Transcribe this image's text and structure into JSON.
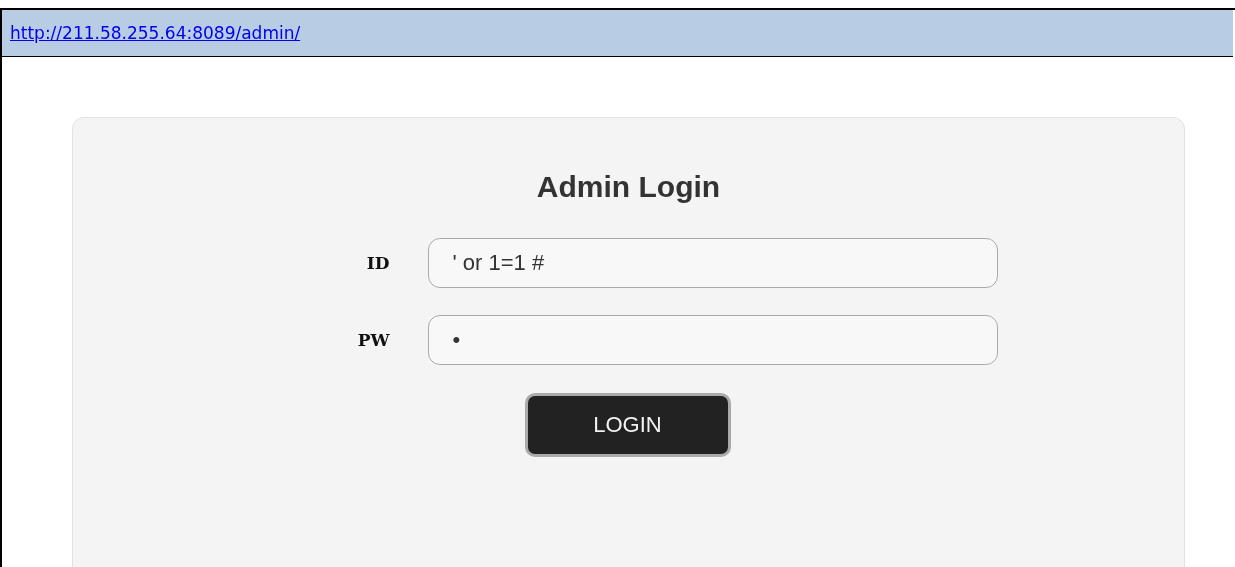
{
  "address_bar": {
    "url": "http://211.58.255.64:8089/admin/"
  },
  "login_form": {
    "title": "Admin Login",
    "fields": [
      {
        "label": "ID",
        "value": "' or 1=1 #"
      },
      {
        "label": "PW",
        "value": "•"
      }
    ],
    "button": "LOGIN"
  }
}
